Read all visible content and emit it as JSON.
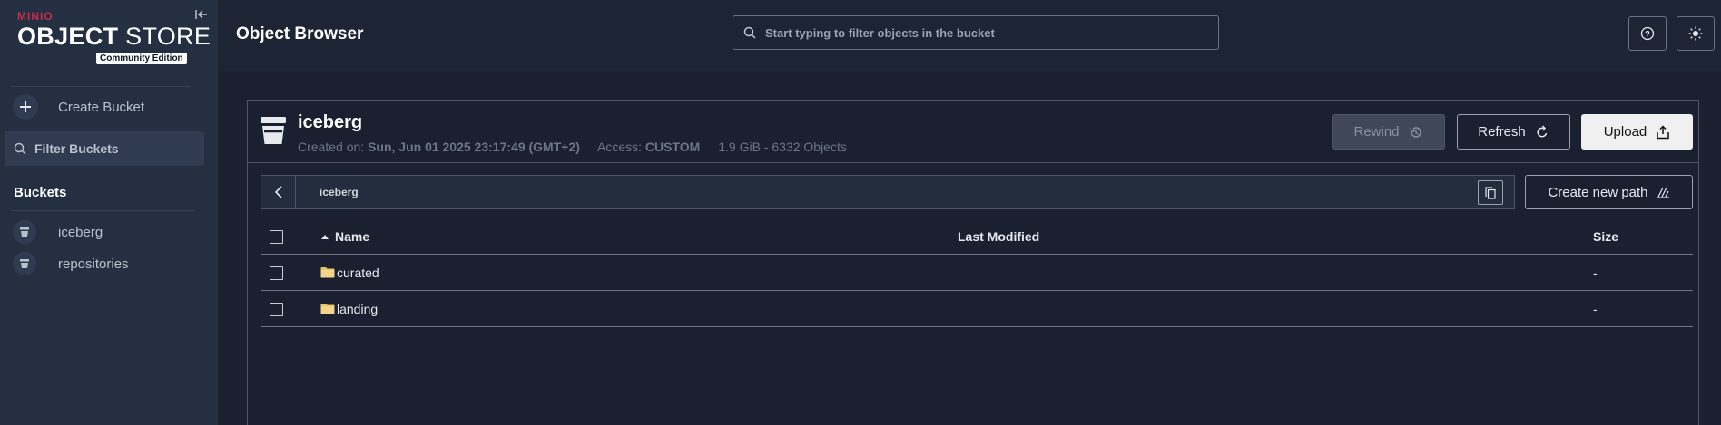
{
  "sidebar": {
    "logo": {
      "brand": "MINIO",
      "product_bold": "OBJECT",
      "product_rest": " STORE",
      "edition": "Community Edition"
    },
    "create_bucket": "Create Bucket",
    "filter_placeholder": "Filter Buckets",
    "buckets_title": "Buckets",
    "buckets": [
      "iceberg",
      "repositories"
    ]
  },
  "header": {
    "title": "Object Browser",
    "search_placeholder": "Start typing to filter objects in the bucket"
  },
  "bucket": {
    "name": "iceberg",
    "created_label": "Created on:",
    "created_value": "Sun, Jun 01 2025 23:17:49 (GMT+2)",
    "access_label": "Access:",
    "access_value": "CUSTOM",
    "usage": "1.9 GiB - 6332 Objects"
  },
  "actions": {
    "rewind": "Rewind",
    "refresh": "Refresh",
    "upload": "Upload",
    "create_path": "Create new path"
  },
  "path": "iceberg",
  "table": {
    "columns": {
      "name": "Name",
      "modified": "Last Modified",
      "size": "Size"
    },
    "rows": [
      {
        "name": "curated",
        "modified": "",
        "size": "-"
      },
      {
        "name": "landing",
        "modified": "",
        "size": "-"
      }
    ]
  },
  "colors": {
    "sidebar_bg": "#243042",
    "page_bg": "#1a2030",
    "brand": "#c72c48"
  }
}
